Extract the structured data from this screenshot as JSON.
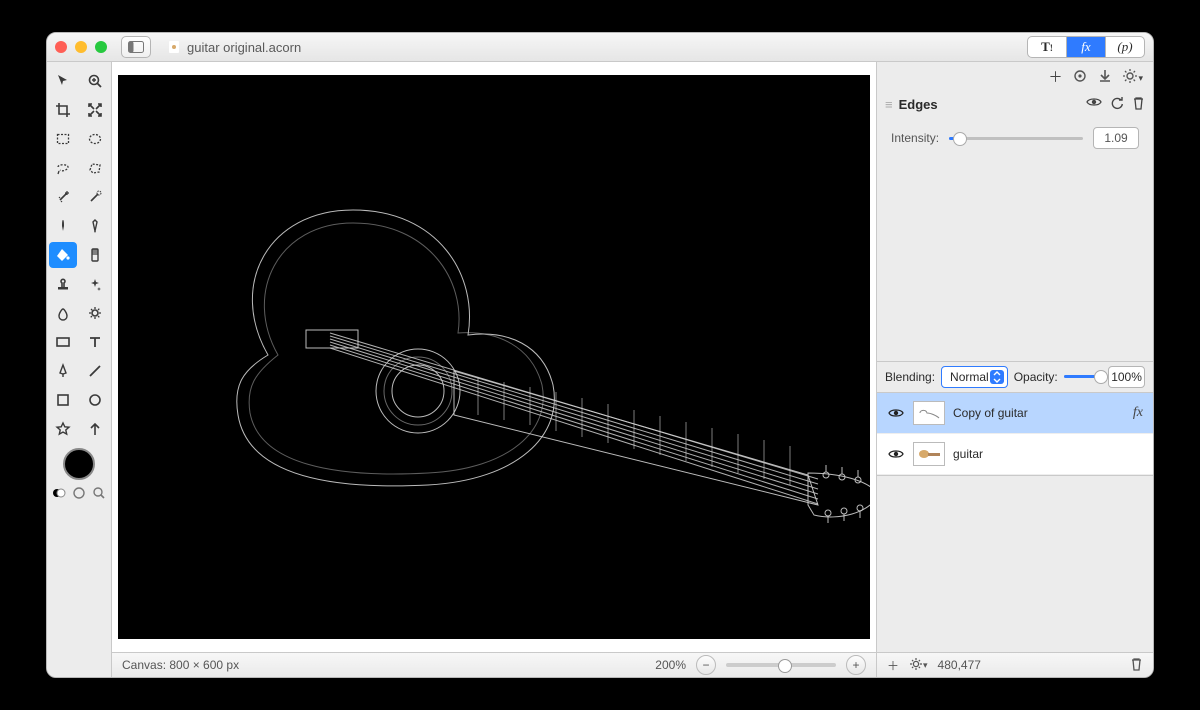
{
  "titlebar": {
    "filename": "guitar original.acorn",
    "tabs": {
      "t_label": "T!",
      "fx_label": "fx",
      "p_label": "(p)",
      "active_index": 1
    }
  },
  "fx_toolbar": {
    "icons": [
      "plus-icon",
      "preset-icon",
      "download-icon",
      "gear-icon"
    ]
  },
  "effect": {
    "name": "Edges",
    "intensity_label": "Intensity:",
    "intensity_value": "1.09",
    "intensity_fill_pct": 8,
    "icons": [
      "eye-icon",
      "revert-icon",
      "trash-icon"
    ]
  },
  "blend": {
    "label": "Blending:",
    "mode": "Normal",
    "opacity_label": "Opacity:",
    "opacity_value": "100%"
  },
  "layers": [
    {
      "name": "Copy of guitar",
      "visible": true,
      "has_fx": true,
      "thumb": "guitar_bw"
    },
    {
      "name": "guitar",
      "visible": true,
      "has_fx": false,
      "thumb": "guitar_color"
    }
  ],
  "layers_status": {
    "plus_label": "+",
    "coords": "480,477"
  },
  "statusbar": {
    "canvas_label": "Canvas: 800 × 600 px",
    "zoom_label": "200%"
  },
  "tools": {
    "selected": "bucket-tool"
  },
  "colors": {
    "foreground": "#000000"
  }
}
